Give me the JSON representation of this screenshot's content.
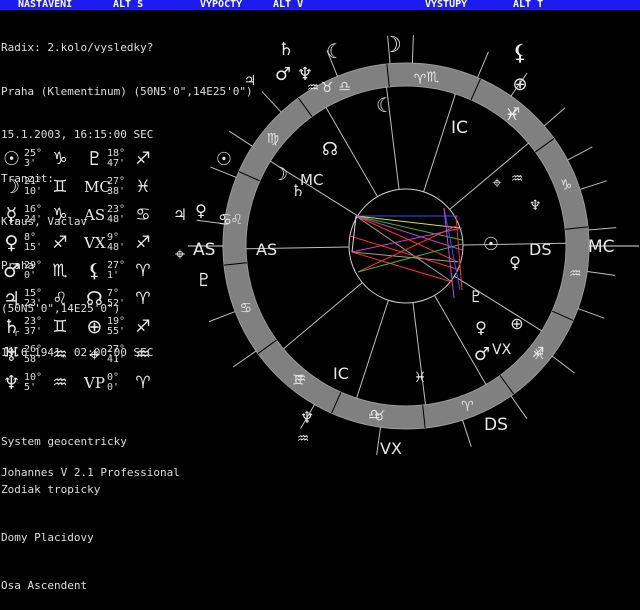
{
  "menu": {
    "items": [
      "NASTAVENI",
      "ALT S",
      "VYPOCTY",
      "ALT V",
      "VYSTUPY",
      "ALT T"
    ]
  },
  "radix": {
    "header": "Radix: 2.kolo/vysledky?",
    "place": "Praha (Klementinum) (50N5'0\",14E25'0\")",
    "datetime": "15.1.2003, 16:15:00 SEC"
  },
  "tranzit": {
    "header": "Tranzit:",
    "name": "Klaus, Vaclav",
    "place": "Praha",
    "coords": "(50N5'0\",14E25'0\")",
    "datetime": "19.6.1941, 02:00:00 SEC"
  },
  "planets": [
    {
      "symbol": "☉",
      "deg": "25°",
      "min": "3'",
      "sign": "♑",
      "retro": ""
    },
    {
      "symbol": "♇",
      "deg": "18°",
      "min": "47'",
      "sign": "♐",
      "retro": ""
    },
    {
      "symbol": "☽",
      "deg": "21°",
      "min": "10'",
      "sign": "♊",
      "retro": ""
    },
    {
      "symbol": "MC",
      "deg": "27°",
      "min": "38'",
      "sign": "♓",
      "retro": ""
    },
    {
      "symbol": "☿",
      "deg": "16°",
      "min": "24'",
      "sign": "♑",
      "retro": "r"
    },
    {
      "symbol": "AS",
      "deg": "23°",
      "min": "48'",
      "sign": "♋",
      "retro": ""
    },
    {
      "symbol": "♀",
      "deg": "8°",
      "min": "15'",
      "sign": "♐",
      "retro": ""
    },
    {
      "symbol": "VX",
      "deg": "9°",
      "min": "48'",
      "sign": "♐",
      "retro": ""
    },
    {
      "symbol": "♂",
      "deg": "29°",
      "min": "0'",
      "sign": "♏",
      "retro": ""
    },
    {
      "symbol": "⚸",
      "deg": "27°",
      "min": "1'",
      "sign": "♈",
      "retro": ""
    },
    {
      "symbol": "♃",
      "deg": "15°",
      "min": "23'",
      "sign": "♌",
      "retro": "r"
    },
    {
      "symbol": "☊",
      "deg": "7°",
      "min": "52'",
      "sign": "♈",
      "retro": ""
    },
    {
      "symbol": "♄",
      "deg": "23°",
      "min": "37'",
      "sign": "♊",
      "retro": "r"
    },
    {
      "symbol": "⊕",
      "deg": "19°",
      "min": "55'",
      "sign": "♐",
      "retro": ""
    },
    {
      "symbol": "♅",
      "deg": "26°",
      "min": "58'",
      "sign": "♒",
      "retro": ""
    },
    {
      "symbol": "⌖",
      "deg": "27°",
      "min": "41'",
      "sign": "♒",
      "retro": ""
    },
    {
      "symbol": "♆",
      "deg": "10°",
      "min": "5'",
      "sign": "♒",
      "retro": ""
    },
    {
      "symbol": "VP",
      "deg": "0°",
      "min": "0'",
      "sign": "♈",
      "retro": ""
    }
  ],
  "settings": {
    "system": "System geocentricky",
    "zodiac": "Zodiak tropicky",
    "houses": "Domy Placidovy",
    "axis": "Osa Ascendent"
  },
  "version": "Johannes V 2.1 Professional",
  "wheel": {
    "zodiac_ring_signs": [
      "♋",
      "♊",
      "♉",
      "♈",
      "♓",
      "♒",
      "♑",
      "♐",
      "♏",
      "♎",
      "♍",
      "♌"
    ],
    "outer_labels": {
      "asc": "AS",
      "mc": "MC",
      "dsc": "DS",
      "ic": "IC",
      "vx": "VX"
    },
    "inner_labels": {
      "asc": "AS",
      "mc": "MC",
      "dsc": "DS",
      "ic": "IC",
      "vx": "VX"
    },
    "house_numbers": [],
    "colors": {
      "ring": "#808080",
      "line_blue": "#3050ff",
      "line_red": "#ff3030",
      "line_yellow": "#e0e040",
      "line_green": "#30c030",
      "line_magenta": "#d040d0",
      "line_grey": "#a0a0a0"
    }
  }
}
